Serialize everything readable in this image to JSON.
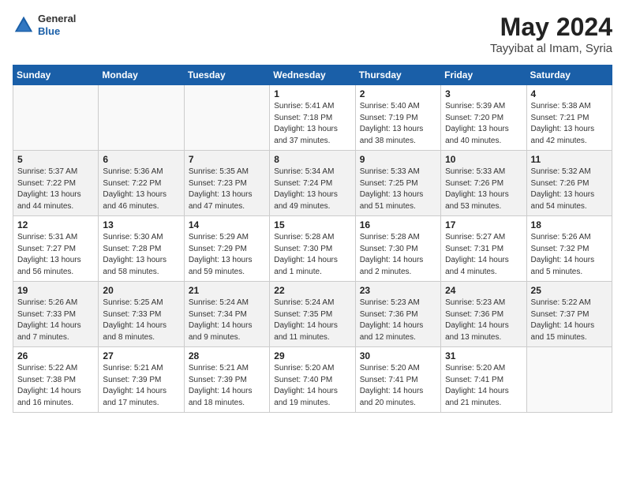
{
  "header": {
    "logo": {
      "general": "General",
      "blue": "Blue"
    },
    "title": "May 2024",
    "location": "Tayyibat al Imam, Syria"
  },
  "calendar": {
    "days_of_week": [
      "Sunday",
      "Monday",
      "Tuesday",
      "Wednesday",
      "Thursday",
      "Friday",
      "Saturday"
    ],
    "weeks": [
      [
        {
          "day": "",
          "info": ""
        },
        {
          "day": "",
          "info": ""
        },
        {
          "day": "",
          "info": ""
        },
        {
          "day": "1",
          "info": "Sunrise: 5:41 AM\nSunset: 7:18 PM\nDaylight: 13 hours\nand 37 minutes."
        },
        {
          "day": "2",
          "info": "Sunrise: 5:40 AM\nSunset: 7:19 PM\nDaylight: 13 hours\nand 38 minutes."
        },
        {
          "day": "3",
          "info": "Sunrise: 5:39 AM\nSunset: 7:20 PM\nDaylight: 13 hours\nand 40 minutes."
        },
        {
          "day": "4",
          "info": "Sunrise: 5:38 AM\nSunset: 7:21 PM\nDaylight: 13 hours\nand 42 minutes."
        }
      ],
      [
        {
          "day": "5",
          "info": "Sunrise: 5:37 AM\nSunset: 7:22 PM\nDaylight: 13 hours\nand 44 minutes."
        },
        {
          "day": "6",
          "info": "Sunrise: 5:36 AM\nSunset: 7:22 PM\nDaylight: 13 hours\nand 46 minutes."
        },
        {
          "day": "7",
          "info": "Sunrise: 5:35 AM\nSunset: 7:23 PM\nDaylight: 13 hours\nand 47 minutes."
        },
        {
          "day": "8",
          "info": "Sunrise: 5:34 AM\nSunset: 7:24 PM\nDaylight: 13 hours\nand 49 minutes."
        },
        {
          "day": "9",
          "info": "Sunrise: 5:33 AM\nSunset: 7:25 PM\nDaylight: 13 hours\nand 51 minutes."
        },
        {
          "day": "10",
          "info": "Sunrise: 5:33 AM\nSunset: 7:26 PM\nDaylight: 13 hours\nand 53 minutes."
        },
        {
          "day": "11",
          "info": "Sunrise: 5:32 AM\nSunset: 7:26 PM\nDaylight: 13 hours\nand 54 minutes."
        }
      ],
      [
        {
          "day": "12",
          "info": "Sunrise: 5:31 AM\nSunset: 7:27 PM\nDaylight: 13 hours\nand 56 minutes."
        },
        {
          "day": "13",
          "info": "Sunrise: 5:30 AM\nSunset: 7:28 PM\nDaylight: 13 hours\nand 58 minutes."
        },
        {
          "day": "14",
          "info": "Sunrise: 5:29 AM\nSunset: 7:29 PM\nDaylight: 13 hours\nand 59 minutes."
        },
        {
          "day": "15",
          "info": "Sunrise: 5:28 AM\nSunset: 7:30 PM\nDaylight: 14 hours\nand 1 minute."
        },
        {
          "day": "16",
          "info": "Sunrise: 5:28 AM\nSunset: 7:30 PM\nDaylight: 14 hours\nand 2 minutes."
        },
        {
          "day": "17",
          "info": "Sunrise: 5:27 AM\nSunset: 7:31 PM\nDaylight: 14 hours\nand 4 minutes."
        },
        {
          "day": "18",
          "info": "Sunrise: 5:26 AM\nSunset: 7:32 PM\nDaylight: 14 hours\nand 5 minutes."
        }
      ],
      [
        {
          "day": "19",
          "info": "Sunrise: 5:26 AM\nSunset: 7:33 PM\nDaylight: 14 hours\nand 7 minutes."
        },
        {
          "day": "20",
          "info": "Sunrise: 5:25 AM\nSunset: 7:33 PM\nDaylight: 14 hours\nand 8 minutes."
        },
        {
          "day": "21",
          "info": "Sunrise: 5:24 AM\nSunset: 7:34 PM\nDaylight: 14 hours\nand 9 minutes."
        },
        {
          "day": "22",
          "info": "Sunrise: 5:24 AM\nSunset: 7:35 PM\nDaylight: 14 hours\nand 11 minutes."
        },
        {
          "day": "23",
          "info": "Sunrise: 5:23 AM\nSunset: 7:36 PM\nDaylight: 14 hours\nand 12 minutes."
        },
        {
          "day": "24",
          "info": "Sunrise: 5:23 AM\nSunset: 7:36 PM\nDaylight: 14 hours\nand 13 minutes."
        },
        {
          "day": "25",
          "info": "Sunrise: 5:22 AM\nSunset: 7:37 PM\nDaylight: 14 hours\nand 15 minutes."
        }
      ],
      [
        {
          "day": "26",
          "info": "Sunrise: 5:22 AM\nSunset: 7:38 PM\nDaylight: 14 hours\nand 16 minutes."
        },
        {
          "day": "27",
          "info": "Sunrise: 5:21 AM\nSunset: 7:39 PM\nDaylight: 14 hours\nand 17 minutes."
        },
        {
          "day": "28",
          "info": "Sunrise: 5:21 AM\nSunset: 7:39 PM\nDaylight: 14 hours\nand 18 minutes."
        },
        {
          "day": "29",
          "info": "Sunrise: 5:20 AM\nSunset: 7:40 PM\nDaylight: 14 hours\nand 19 minutes."
        },
        {
          "day": "30",
          "info": "Sunrise: 5:20 AM\nSunset: 7:41 PM\nDaylight: 14 hours\nand 20 minutes."
        },
        {
          "day": "31",
          "info": "Sunrise: 5:20 AM\nSunset: 7:41 PM\nDaylight: 14 hours\nand 21 minutes."
        },
        {
          "day": "",
          "info": ""
        }
      ]
    ]
  }
}
